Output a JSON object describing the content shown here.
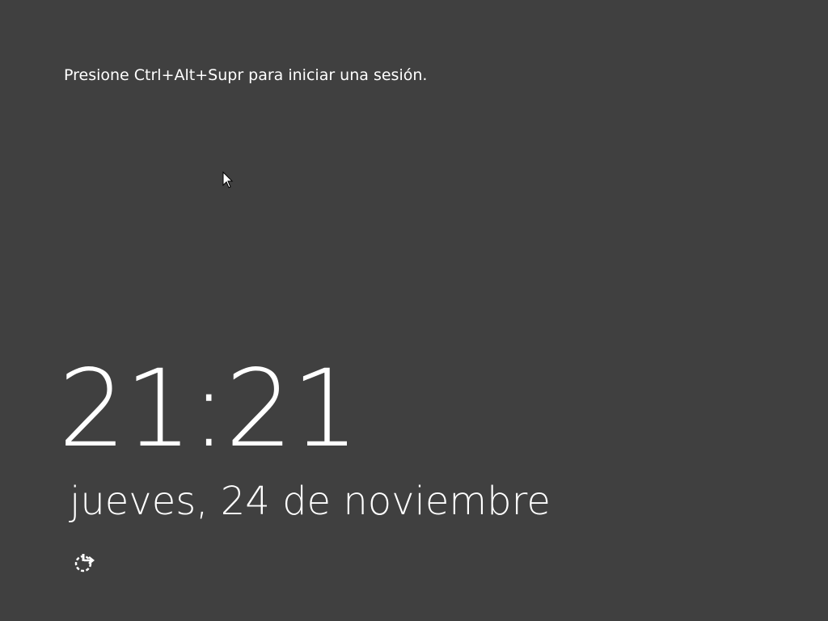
{
  "lock_screen": {
    "prompt": "Presione Ctrl+Alt+Supr para iniciar una sesión.",
    "time": "21:21",
    "date": "jueves, 24 de noviembre",
    "ease_of_access_icon": "ease-of-access-icon"
  },
  "colors": {
    "background": "#404040",
    "text": "#ffffff"
  }
}
